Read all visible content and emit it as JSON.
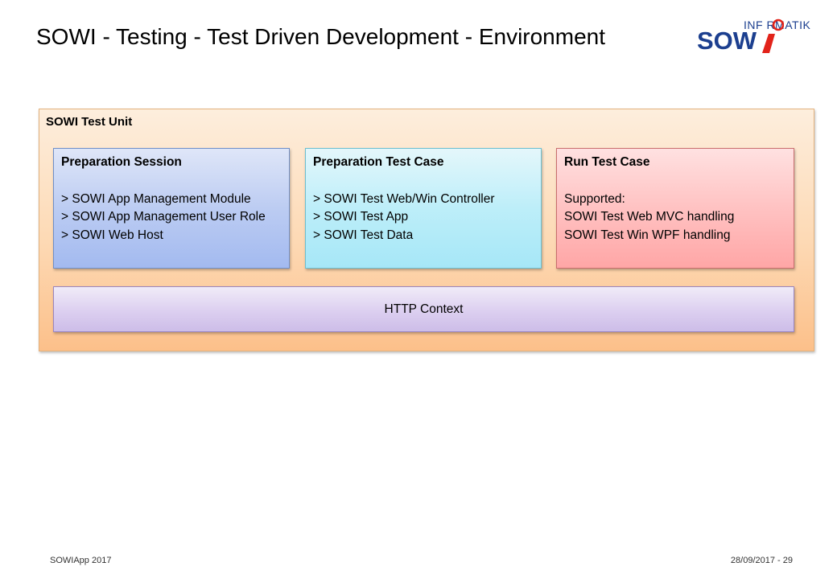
{
  "slide": {
    "title": "SOWI - Testing - Test Driven Development - Environment"
  },
  "logo": {
    "top_text": "INF RMATIK",
    "main_text": "SOW",
    "colors": {
      "blue": "#1c3f8f",
      "red": "#e2231a"
    }
  },
  "unit": {
    "label": "SOWI Test Unit",
    "cards": [
      {
        "title": "Preparation Session",
        "lines": [
          "> SOWI App Management Module",
          "> SOWI App Management User Role",
          "> SOWI Web Host"
        ]
      },
      {
        "title": "Preparation Test Case",
        "lines": [
          "> SOWI Test Web/Win Controller",
          "> SOWI Test App",
          "> SOWI Test Data"
        ]
      },
      {
        "title": "Run Test Case",
        "lines": [
          "Supported:",
          "SOWI Test Web MVC handling",
          "SOWI Test Win WPF handling"
        ]
      }
    ],
    "context": "HTTP Context"
  },
  "footer": {
    "left": "SOWIApp 2017",
    "right": "28/09/2017 - 29"
  }
}
